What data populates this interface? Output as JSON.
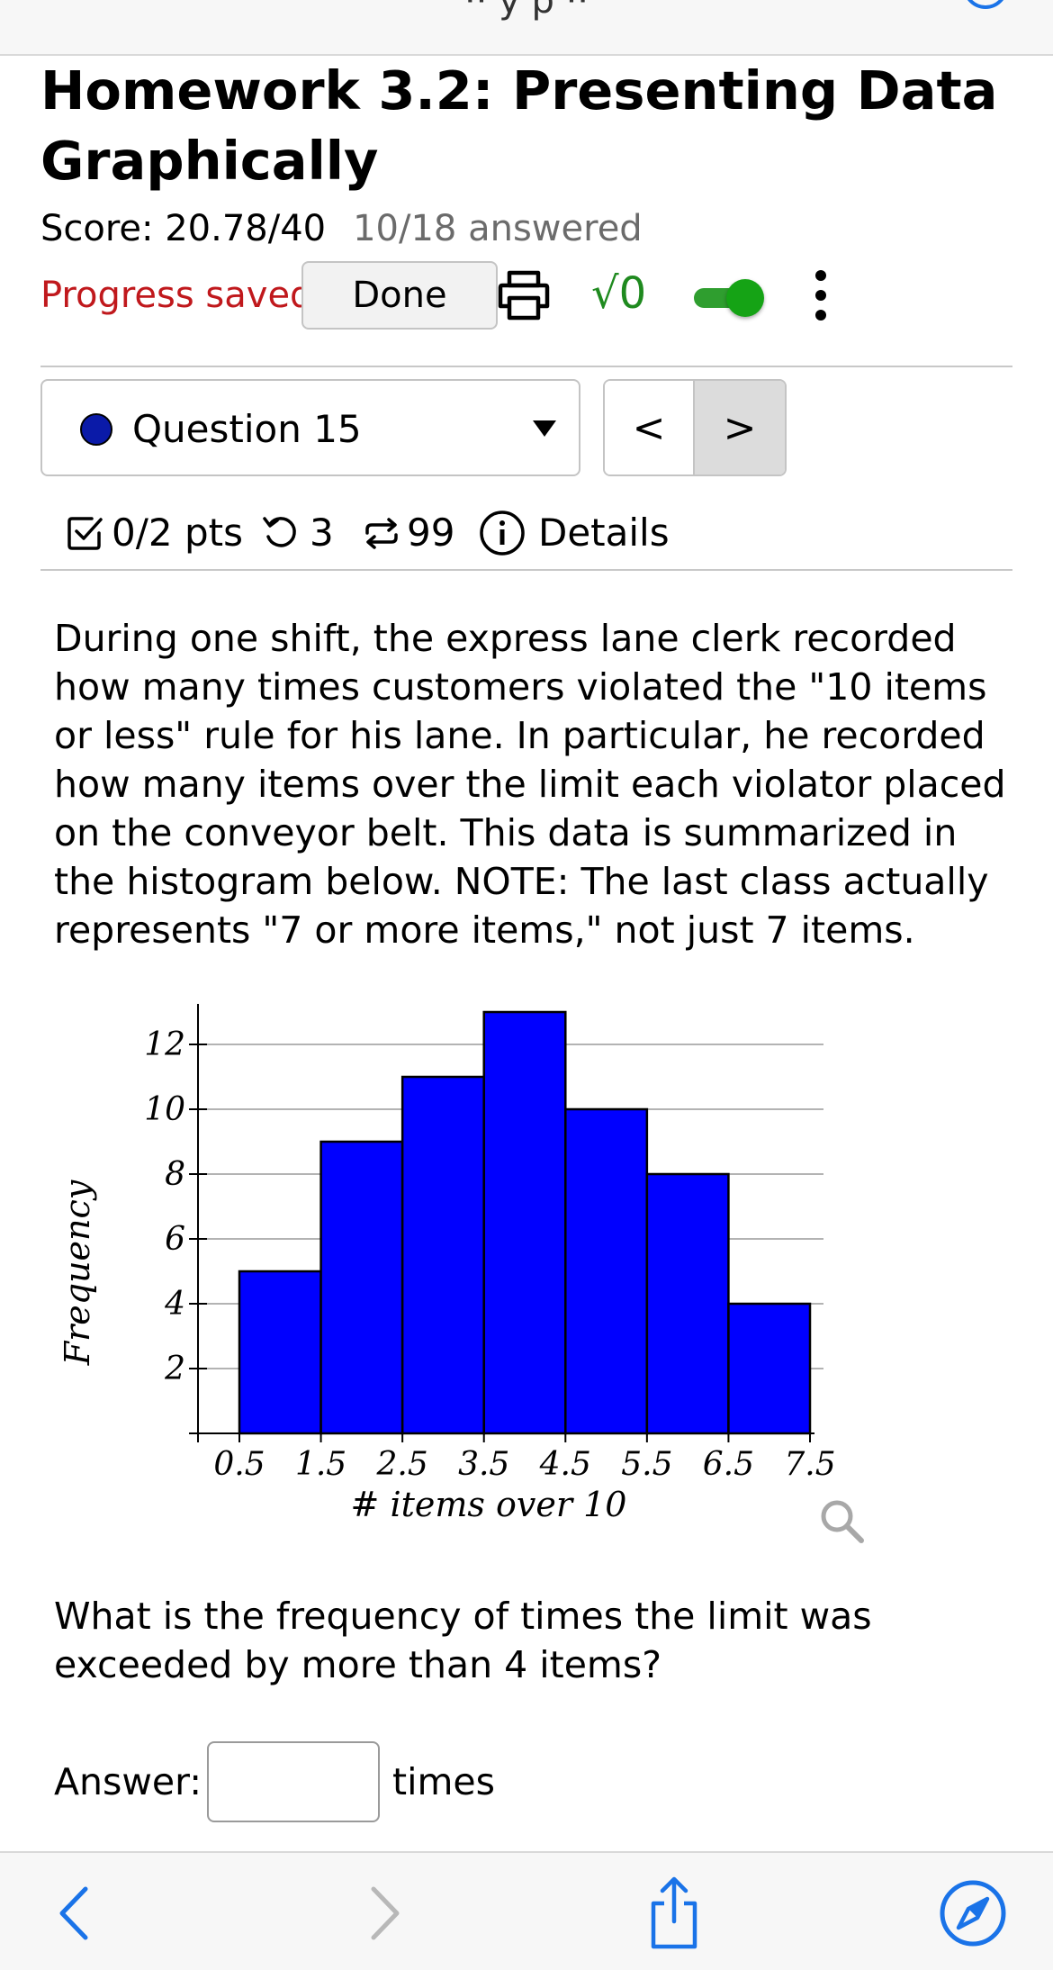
{
  "browser": {
    "top_title_fragment": "·· y p ··"
  },
  "assignment": {
    "title": "Homework 3.2: Presenting Data Graphically",
    "score": "Score: 20.78/40",
    "answered": "10/18 answered",
    "progress_status": "Progress saved",
    "done_label": "Done",
    "math_toggle_label": "√0",
    "math_toggle_on": true
  },
  "question_nav": {
    "selected_question": "Question 15",
    "prev_label": "<",
    "next_label": ">"
  },
  "question_meta": {
    "points": "0/2 pts",
    "retries": "3",
    "attempts": "99",
    "details_label": "Details"
  },
  "question": {
    "prompt": "During one shift, the express lane clerk recorded how many times customers violated the \"10 items or less\" rule for his lane. In particular, he recorded how many items over the limit each violator placed on the conveyor belt. This data is summarized in the histogram below. NOTE: The last class actually represents \"7 or more items,\" not just 7 items.",
    "ask": "What is the frequency of times the limit was exceeded by more than 4 items?",
    "answer_label": "Answer:",
    "answer_value": "",
    "answer_unit": "times"
  },
  "chart_data": {
    "type": "bar",
    "histogram": true,
    "bin_edges": [
      0.5,
      1.5,
      2.5,
      3.5,
      4.5,
      5.5,
      6.5,
      7.5
    ],
    "x_tick_labels": [
      "0.5",
      "1.5",
      "2.5",
      "3.5",
      "4.5",
      "5.5",
      "6.5",
      "7.5"
    ],
    "values": [
      5,
      9,
      11,
      13,
      10,
      8,
      4
    ],
    "y_ticks": [
      2,
      4,
      6,
      8,
      10,
      12
    ],
    "ylim": [
      0,
      13
    ],
    "xlabel": "# items over 10",
    "ylabel": "Frequency",
    "title": "",
    "grid": true,
    "bar_color": "#0000ff"
  },
  "colors": {
    "progress_red": "#c0181c",
    "math_green": "#1f8a1f",
    "accent_blue": "#1a73e8",
    "question_dot": "#0a1aa8"
  }
}
